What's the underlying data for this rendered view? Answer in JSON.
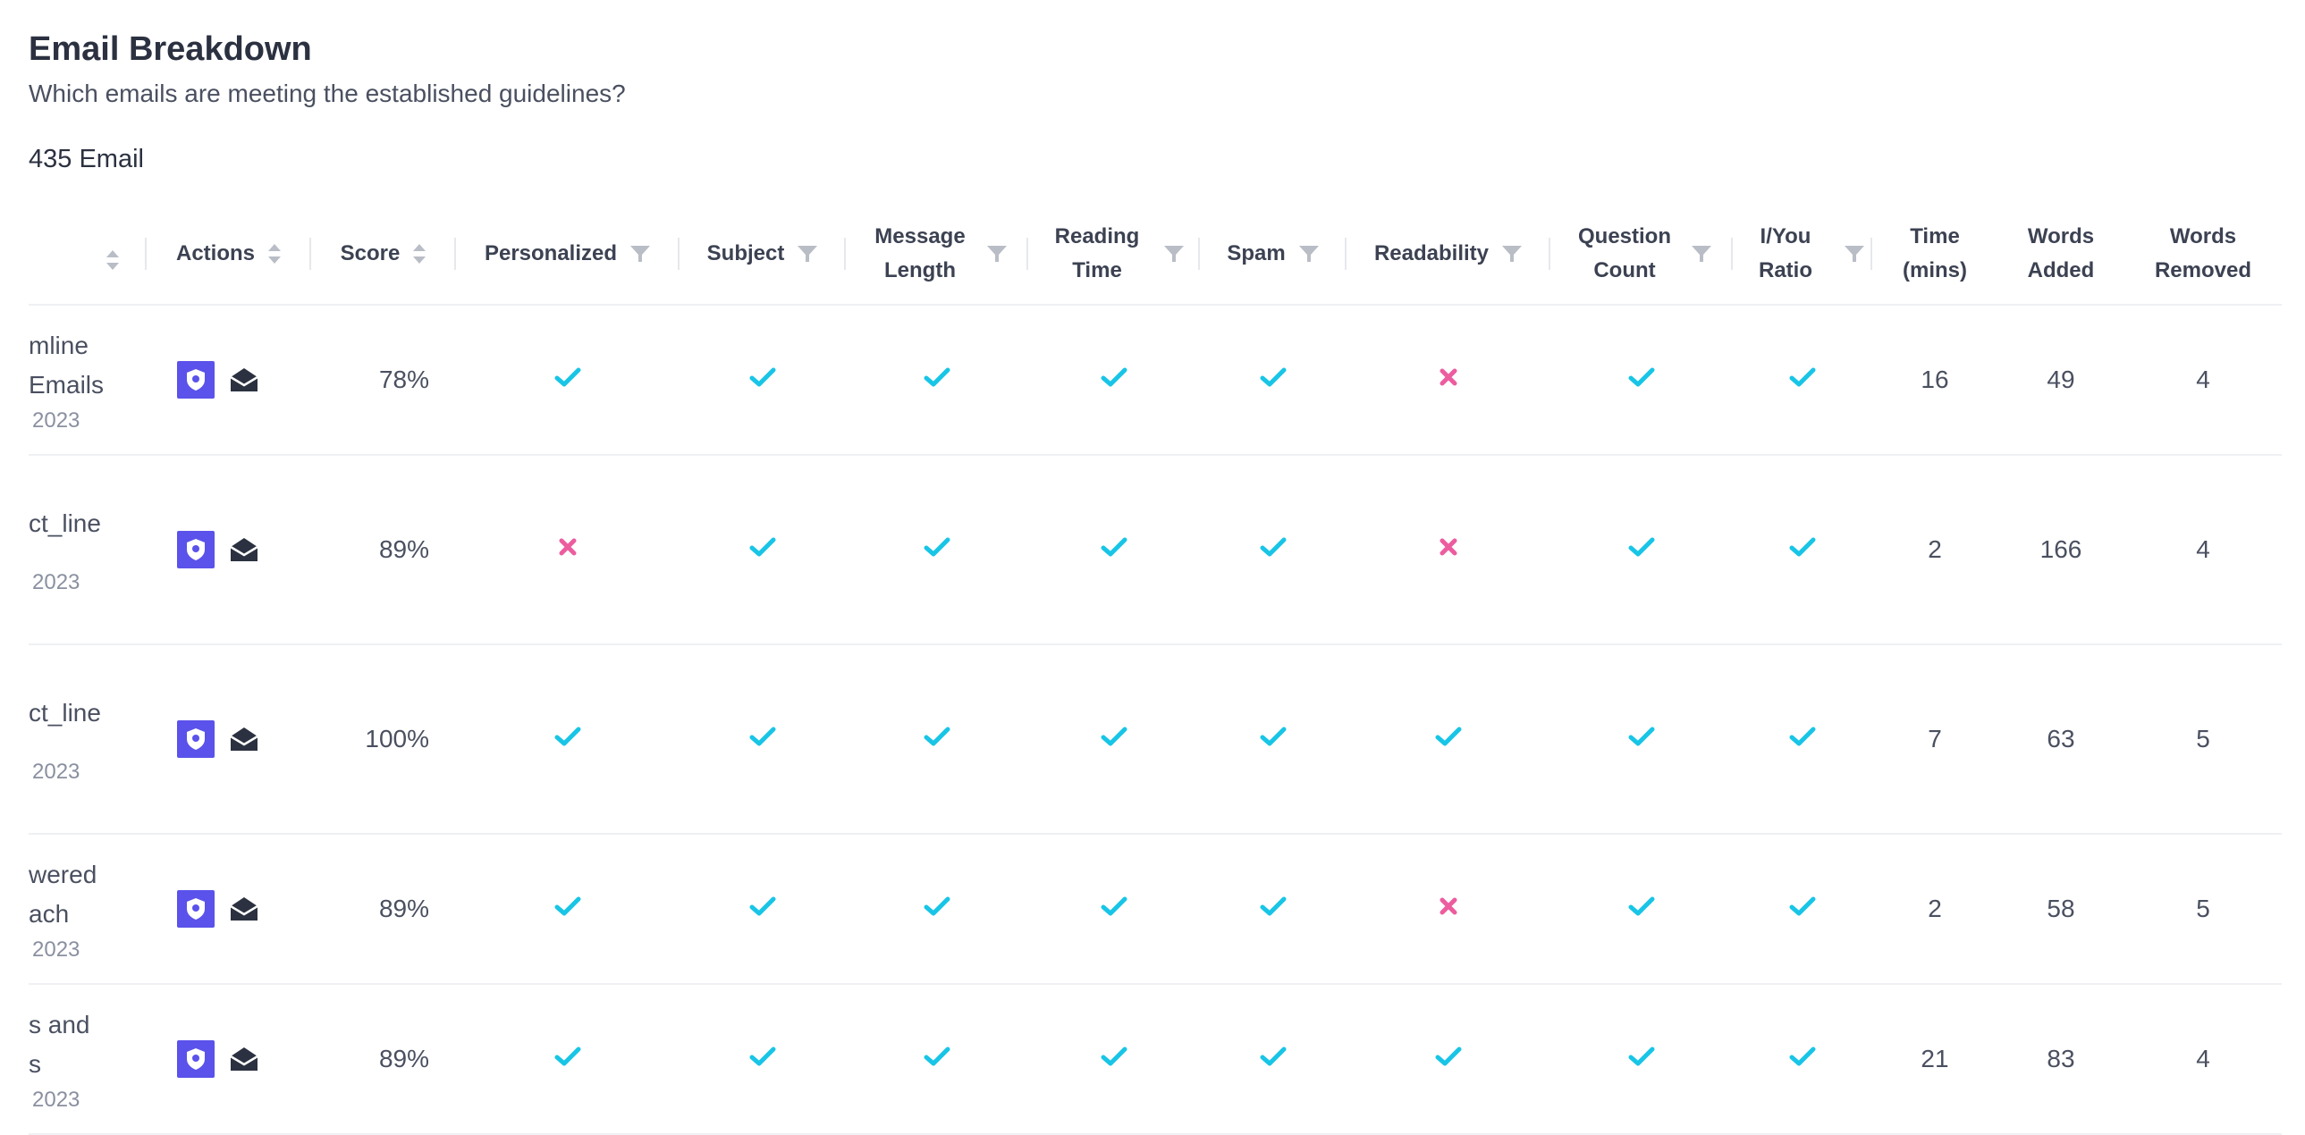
{
  "header": {
    "title": "Email Breakdown",
    "subtitle": "Which emails are meeting the established guidelines?",
    "count_label": "435 Email"
  },
  "colors": {
    "check": "#18c5e6",
    "cross": "#ec5d9f",
    "shield_button": "#5a52ea",
    "mail_icon": "#2b3140"
  },
  "columns": [
    {
      "key": "name",
      "label": "",
      "icon": "sort-icon"
    },
    {
      "key": "actions",
      "label": "Actions",
      "icon": "sort-icon"
    },
    {
      "key": "score",
      "label": "Score",
      "icon": "sort-icon"
    },
    {
      "key": "personalized",
      "label": "Personalized",
      "icon": "filter-icon"
    },
    {
      "key": "subject",
      "label": "Subject",
      "icon": "filter-icon"
    },
    {
      "key": "message_length",
      "label": "Message Length",
      "icon": "filter-icon"
    },
    {
      "key": "reading_time",
      "label": "Reading Time",
      "icon": "filter-icon"
    },
    {
      "key": "spam",
      "label": "Spam",
      "icon": "filter-icon"
    },
    {
      "key": "readability",
      "label": "Readability",
      "icon": "filter-icon"
    },
    {
      "key": "question_count",
      "label": "Question Count",
      "icon": "filter-icon"
    },
    {
      "key": "i_you_ratio",
      "label": "I/You Ratio",
      "icon": "filter-icon"
    },
    {
      "key": "time_mins",
      "label": "Time (mins)",
      "icon": ""
    },
    {
      "key": "words_added",
      "label": "Words Added",
      "icon": ""
    },
    {
      "key": "words_removed",
      "label": "Words Removed",
      "icon": ""
    }
  ],
  "rows": [
    {
      "name_lines": [
        "mline",
        "Emails"
      ],
      "date": "2023",
      "score": "78%",
      "checks": [
        true,
        true,
        true,
        true,
        true,
        false,
        true,
        true
      ],
      "time": "16",
      "added": "49",
      "removed": "4"
    },
    {
      "name_lines": [
        "ct_line"
      ],
      "date": "2023",
      "score": "89%",
      "checks": [
        false,
        true,
        true,
        true,
        true,
        false,
        true,
        true
      ],
      "time": "2",
      "added": "166",
      "removed": "4"
    },
    {
      "name_lines": [
        "ct_line"
      ],
      "date": "2023",
      "score": "100%",
      "checks": [
        true,
        true,
        true,
        true,
        true,
        true,
        true,
        true
      ],
      "time": "7",
      "added": "63",
      "removed": "5"
    },
    {
      "name_lines": [
        "wered",
        "ach"
      ],
      "date": "2023",
      "score": "89%",
      "checks": [
        true,
        true,
        true,
        true,
        true,
        false,
        true,
        true
      ],
      "time": "2",
      "added": "58",
      "removed": "5"
    },
    {
      "name_lines": [
        "s and",
        "s"
      ],
      "date": "2023",
      "score": "89%",
      "checks": [
        true,
        true,
        true,
        true,
        true,
        true,
        true,
        true
      ],
      "time": "21",
      "added": "83",
      "removed": "4"
    }
  ]
}
